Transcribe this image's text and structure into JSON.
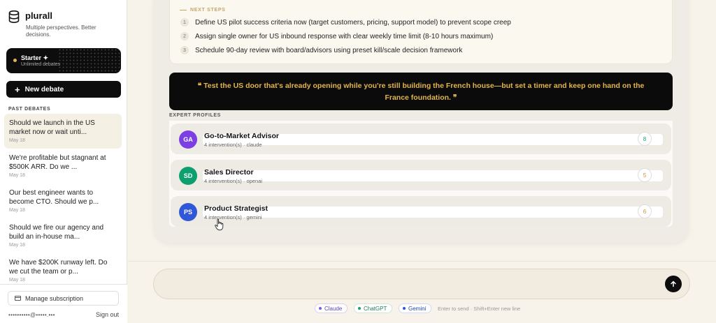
{
  "brand": {
    "name": "plurall",
    "tagline": "Multiple perspectives. Better decisions."
  },
  "plan": {
    "title": "Starter ✦",
    "subtitle": "Unlimited debates",
    "accent": "#e0b25a"
  },
  "sidebar": {
    "new_debate_label": "New debate",
    "past_label": "PAST DEBATES",
    "debates": [
      {
        "question": "Should we launch in the US market now or wait unti...",
        "date": "May 18"
      },
      {
        "question": "We're profitable but stagnant at $500K ARR. Do we ...",
        "date": "May 18"
      },
      {
        "question": "Our best engineer wants to become CTO. Should we p...",
        "date": "May 18"
      },
      {
        "question": "Should we fire our agency and build an in-house ma...",
        "date": "May 18"
      },
      {
        "question": "We have $200K runway left. Do we cut the team or p...",
        "date": "May 18"
      }
    ],
    "manage_label": "Manage subscription",
    "email": "••••••••••@•••••.•••",
    "sign_out": "Sign out"
  },
  "next_steps": {
    "title": "NEXT STEPS",
    "steps": [
      {
        "num": "1",
        "text": "Define US pilot success criteria now (target customers, pricing, support model) to prevent scope creep"
      },
      {
        "num": "2",
        "text": "Assign single owner for US inbound response with clear weekly time limit (8-10 hours maximum)"
      },
      {
        "num": "3",
        "text": "Schedule 90-day review with board/advisors using preset kill/scale decision framework"
      }
    ]
  },
  "quote": {
    "text": "❝ Test the US door that's already opening while you're still building the French house—but set a timer and keep one hand on the France foundation. ❞",
    "color": "#e2b44e"
  },
  "experts": {
    "label": "EXPERT PROFILES",
    "items": [
      {
        "initials": "GA",
        "name": "Go-to-Market Advisor",
        "meta": "4 intervention(s) · claude",
        "score": "8",
        "avatar_color": "#7b3fe4",
        "score_color": "#22a06b"
      },
      {
        "initials": "SD",
        "name": "Sales Director",
        "meta": "4 intervention(s) · openai",
        "score": "5",
        "avatar_color": "#0e9f6e",
        "score_color": "#c9923a"
      },
      {
        "initials": "PS",
        "name": "Product Strategist",
        "meta": "4 intervention(s) · gemini",
        "score": "6",
        "avatar_color": "#2f57d8",
        "score_color": "#c9923a"
      }
    ]
  },
  "composer": {
    "models": [
      {
        "label": "Claude",
        "color": "#7b5be0"
      },
      {
        "label": "ChatGPT",
        "color": "#22a06b"
      },
      {
        "label": "Gemini",
        "color": "#2f57d8"
      }
    ],
    "hint": "Enter to send · Shift+Enter new line"
  }
}
